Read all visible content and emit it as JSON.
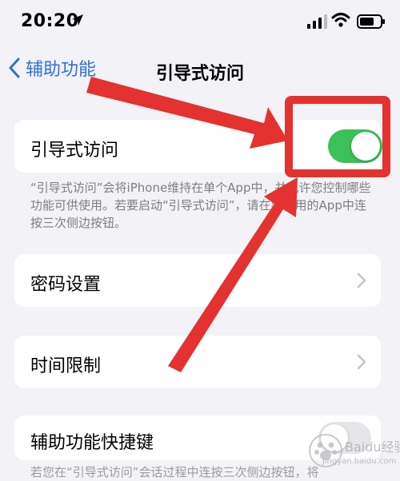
{
  "status_bar": {
    "time": "20:20"
  },
  "nav": {
    "back_label": "辅助功能",
    "title": "引导式访问"
  },
  "guided_access": {
    "label": "引导式访问",
    "toggle_on": true,
    "footnote": "“引导式访问”会将iPhone维持在单个App中，并允许您控制哪些功能可供使用。若要启动“引导式访问”，请在要使用的App中连按三次侧边按钮。"
  },
  "rows": [
    {
      "label": "密码设置"
    },
    {
      "label": "时间限制"
    },
    {
      "label": "辅助功能快捷键"
    }
  ],
  "bottom_footnote": "若您在“引导式访问”会话过程中连按三次侧边按钮，将",
  "colors": {
    "accent": "#2f6fde",
    "toggle_on": "#3ac159",
    "annotation_red": "#e3322f"
  },
  "watermark": {
    "text": "Baidu经验",
    "url_text": "jingyan.baidu.com"
  }
}
